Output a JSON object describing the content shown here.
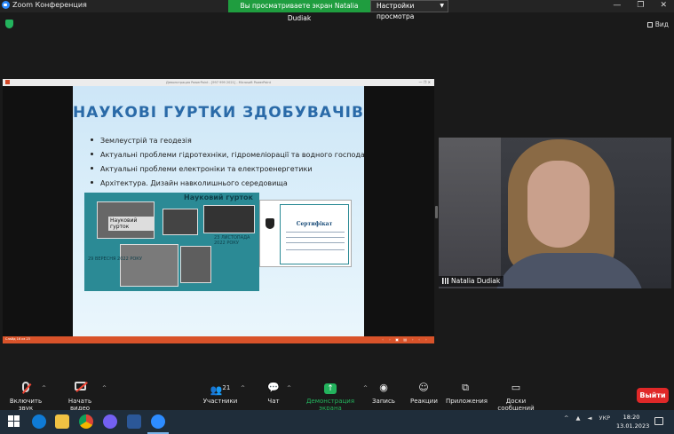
{
  "window": {
    "title": "Zoom Конференция",
    "share_banner": "Вы просматриваете экран Natalia Dudiak",
    "view_options": "Настройки просмотра",
    "view_button": "Вид",
    "minimize": "—",
    "restore": "❐",
    "close": "✕"
  },
  "shared_screen": {
    "ppt_window_title": "Демонстрация PowerPoint - [997 999 2021] - Microsoft PowerPoint",
    "ppt_window_controls": "— ❐ ✕",
    "slide": {
      "title": "НАУКОВІ ГУРТКИ ЗДОБУВАЧІВ",
      "bullets": [
        "Землеустрій та геодезія",
        "Актуальні проблеми гідротехніки, гідромеліорації та водного господарства",
        "Актуальні проблеми електроніки та електроенергетики",
        "Архітектура. Дизайн навколишнього середовища"
      ],
      "collage_heading": "Науковий гурток",
      "collage_photo_label": "Науковий гурток",
      "caption_left": "29 ВЕРЕСНЯ 2022 РОКУ",
      "caption_right": "23 ЛИСТОПАДА 2022 РОКУ",
      "certificate_title": "Сертифікат"
    },
    "statusbar_left": "Слайд 16 из 23",
    "statusbar_right": "◦ ◦ ▣ ▤ ◦ ◦ ◦"
  },
  "participant": {
    "name": "Natalia Dudiak"
  },
  "toolbar": {
    "audio": "Включить звук",
    "video": "Начать видео",
    "participants": "Участники",
    "participants_count": "21",
    "chat": "Чат",
    "share": "Демонстрация экрана",
    "record": "Запись",
    "reactions": "Реакции",
    "apps": "Приложения",
    "whiteboards": "Доски сообщений",
    "leave": "Выйти",
    "caret": "^"
  },
  "taskbar": {
    "language": "УКР",
    "time": "18:20",
    "date": "13.01.2023",
    "apps": [
      "edge",
      "explorer",
      "chrome",
      "viber",
      "word",
      "zoom"
    ]
  },
  "colors": {
    "zoom_green": "#23b35d",
    "leave_red": "#e02828",
    "zoom_blue": "#2d8cff",
    "slide_title": "#2a6aa8"
  }
}
